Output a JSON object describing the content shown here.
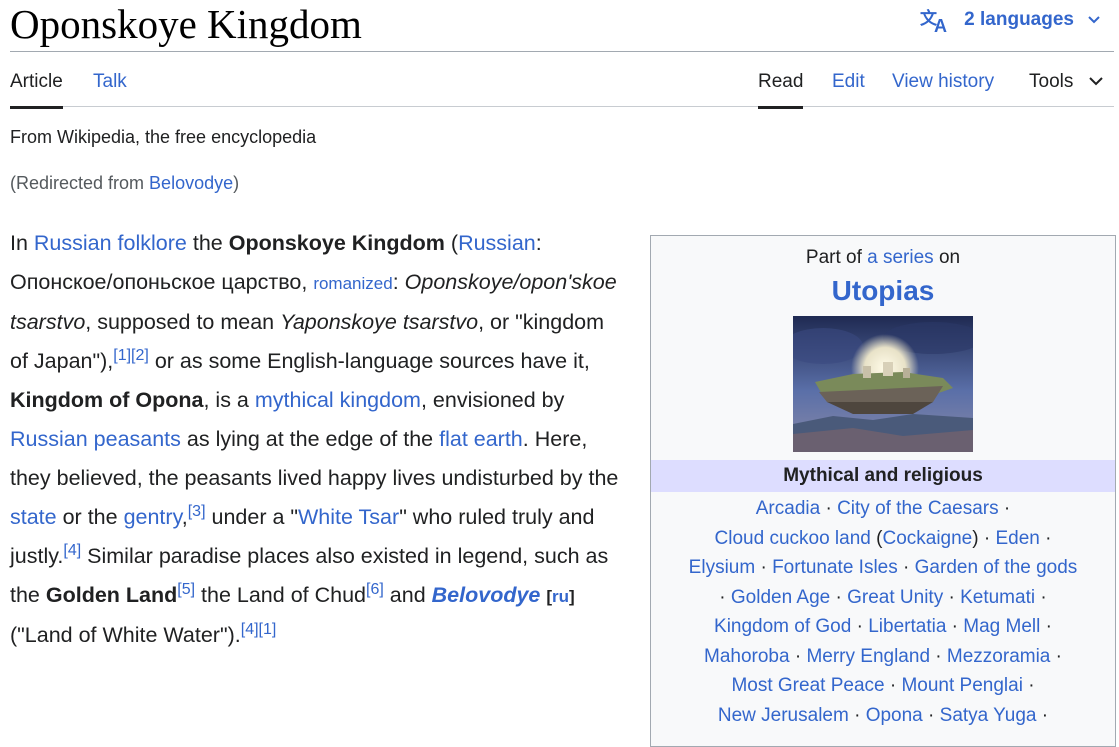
{
  "page": {
    "title": "Oponskoye Kingdom",
    "languages_label": "2 languages",
    "accent_color": "#3366cc"
  },
  "tabs": {
    "article": "Article",
    "talk": "Talk",
    "read": "Read",
    "edit": "Edit",
    "history": "View history",
    "tools": "Tools"
  },
  "meta": {
    "tagline": "From Wikipedia, the free encyclopedia",
    "redirect_prefix": "(Redirected from ",
    "redirect_link": "Belovodye",
    "redirect_suffix": ")"
  },
  "article": {
    "t1": "In ",
    "l_folklore": "Russian folklore",
    "t2": " the ",
    "b_name": "Oponskoye Kingdom",
    "t3": " (",
    "l_russian": "Russian",
    "t4": ": Опонское/опоньское царство, ",
    "l_romanized": "romanized",
    "t5": ": ",
    "i_translit": "Oponskoye/opon'skoe tsarstvo",
    "t6": ", supposed to mean ",
    "i_yapon": "Yaponskoye tsarstvo",
    "t7": ", or \"kingdom of Japan\"),",
    "c1": "[1]",
    "c2": "[2]",
    "t8": " or as some English-language sources have it, ",
    "b_opona": "Kingdom of Opona",
    "t9": ", is a ",
    "l_mythical": "mythical kingdom",
    "t10": ", envisioned by ",
    "l_peasants": "Russian peasants",
    "t11": " as lying at the edge of the ",
    "l_flat": "flat earth",
    "t12": ". Here, they believed, the peasants lived happy lives undisturbed by the ",
    "l_state": "state",
    "t13": " or the ",
    "l_gentry": "gentry",
    "t14": ",",
    "c3": "[3]",
    "t15": " under a \"",
    "l_tsar": "White Tsar",
    "t16": "\" who ruled truly and justly.",
    "c4": "[4]",
    "t17": " Similar paradise places also existed in legend, such as the ",
    "b_golden": "Golden Land",
    "c5": "[5]",
    "t18": " the Land of Chud",
    "c6": "[6]",
    "t19": " and ",
    "bl_belovodye": "Belovodye",
    "t20": " ",
    "ru_open": "[",
    "ru_link": "ru",
    "ru_close": "]",
    "t21": " (\"Land of White Water\").",
    "c7": "[4]",
    "c8": "[1]"
  },
  "infobox": {
    "part_of": "Part of ",
    "series_link": "a series",
    "on": " on",
    "title": "Utopias",
    "section": "Mythical and religious",
    "items": [
      "Arcadia",
      "City of the Caesars",
      "Cloud cuckoo land",
      "Cockaigne",
      "Eden",
      "Elysium",
      "Fortunate Isles",
      "Garden of the gods",
      "Golden Age",
      "Great Unity",
      "Ketumati",
      "Kingdom of God",
      "Libertatia",
      "Mag Mell",
      "Mahoroba",
      "Merry England",
      "Mezzoramia",
      "Most Great Peace",
      "Mount Penglai",
      "New Jerusalem",
      "Opona",
      "Satya Yuga"
    ],
    "sep": " · ",
    "open_paren": " (",
    "close_paren": ")"
  }
}
